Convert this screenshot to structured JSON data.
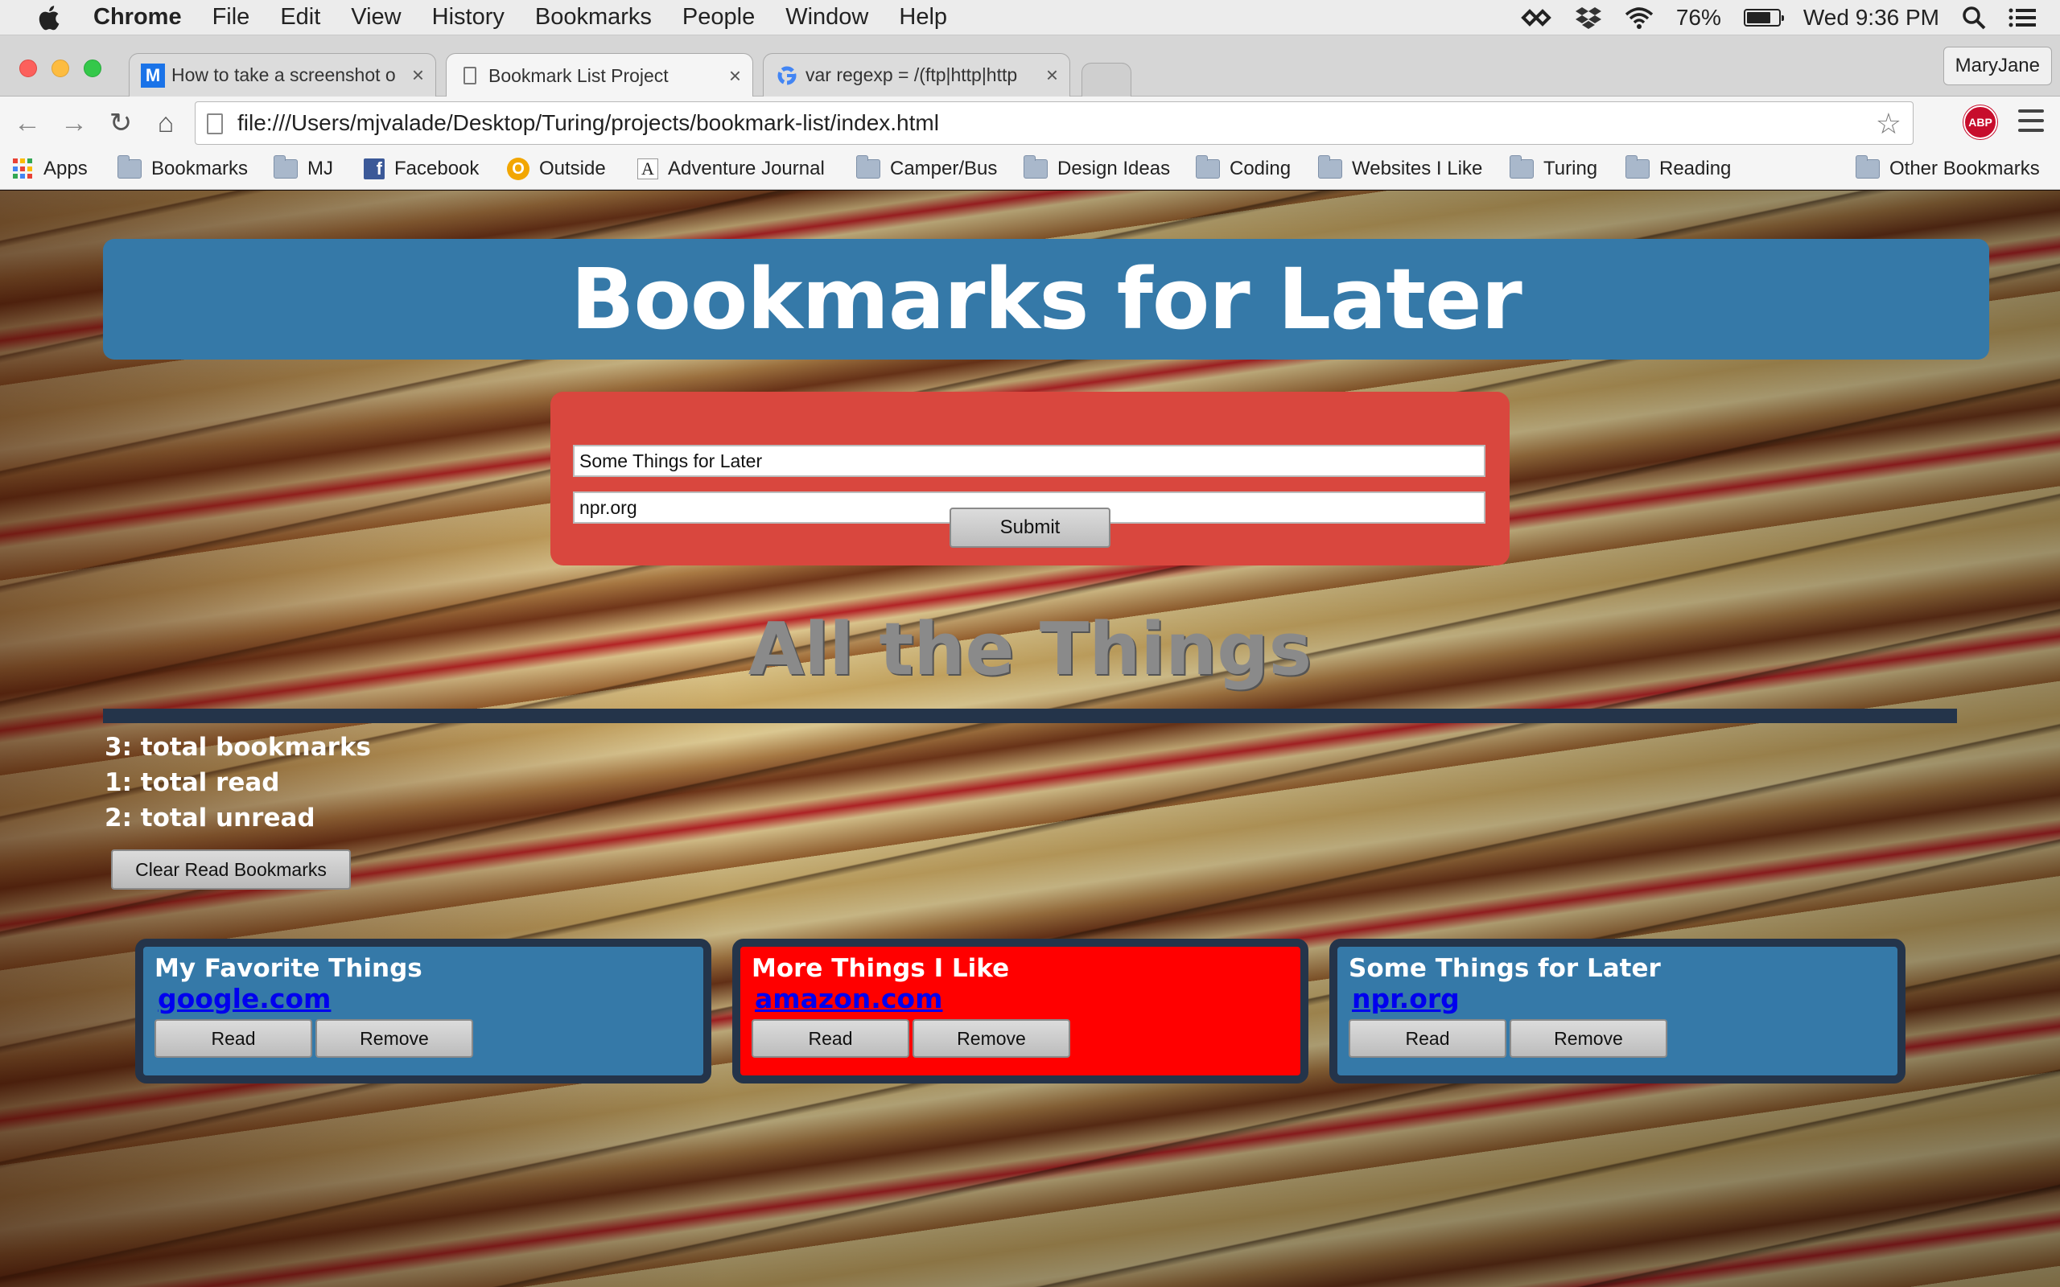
{
  "menubar": {
    "app": "Chrome",
    "items": [
      "File",
      "Edit",
      "View",
      "History",
      "Bookmarks",
      "People",
      "Window",
      "Help"
    ],
    "battery_percent": "76%",
    "battery_level": 0.76,
    "datetime": "Wed 9:36 PM"
  },
  "tabs": [
    {
      "title": "How to take a screenshot o",
      "favicon": "medium-m-icon"
    },
    {
      "title": "Bookmark List Project",
      "favicon": "page-icon"
    },
    {
      "title": "var regexp = /(ftp|http|http",
      "favicon": "google-g-icon"
    }
  ],
  "profile": "MaryJane",
  "url": "file:///Users/mjvalade/Desktop/Turing/projects/bookmark-list/index.html",
  "bookmarks_bar": {
    "apps": "Apps",
    "items": [
      "Bookmarks",
      "MJ",
      "Facebook",
      "Outside",
      "Adventure Journal",
      "Camper/Bus",
      "Design Ideas",
      "Coding",
      "Websites I Like",
      "Turing",
      "Reading"
    ],
    "other": "Other Bookmarks"
  },
  "page": {
    "header": "Bookmarks for Later",
    "form": {
      "title_value": "Some Things for Later",
      "url_value": "npr.org",
      "submit_label": "Submit"
    },
    "section_title": "All the Things",
    "counts": {
      "total": "3: total bookmarks",
      "read": "1: total read",
      "unread": "2: total unread"
    },
    "clear_label": "Clear Read Bookmarks",
    "read_label": "Read",
    "remove_label": "Remove",
    "cards": [
      {
        "title": "My Favorite Things",
        "link": "google.com",
        "read": false,
        "color": "#3579a8"
      },
      {
        "title": "More Things I Like",
        "link": "amazon.com",
        "read": true,
        "color": "#ff0000"
      },
      {
        "title": "Some Things for Later",
        "link": "npr.org",
        "read": false,
        "color": "#3579a8"
      }
    ]
  },
  "colors": {
    "header_bg": "#3579a8",
    "form_bg": "#d9473e",
    "read_card": "#ff0000",
    "card_border": "#24344a"
  }
}
